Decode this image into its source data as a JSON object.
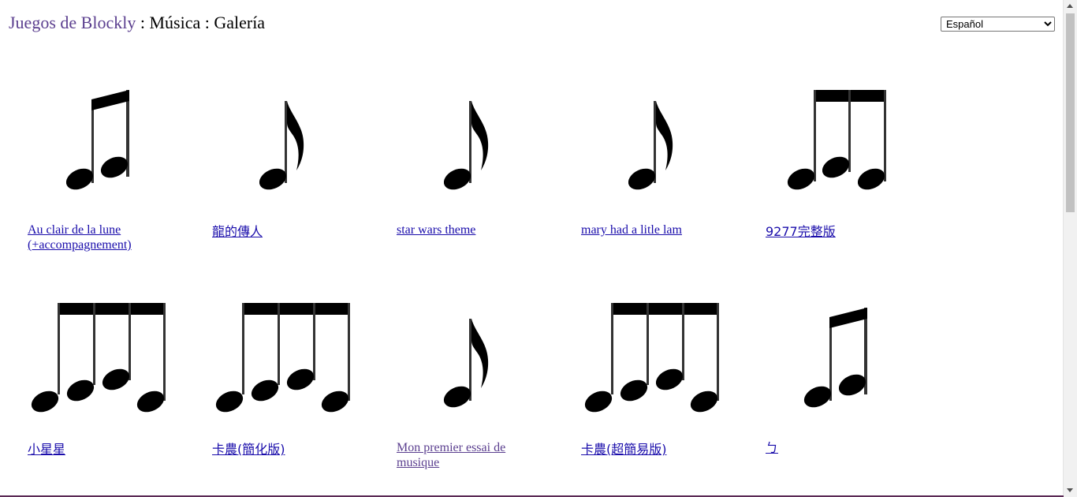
{
  "header": {
    "app_link": "Juegos de Blockly",
    "separator1": " : ",
    "section": "Música",
    "separator2": " : ",
    "page": "Galería"
  },
  "language_select": {
    "selected": "Español"
  },
  "gallery": [
    {
      "title": "Au clair de la lune (+accompagnement)",
      "icon": "beamed-two-notes-icon"
    },
    {
      "title": "龍的傳人",
      "icon": "eighth-note-icon"
    },
    {
      "title": "star wars theme",
      "icon": "eighth-note-icon"
    },
    {
      "title": "mary had a litle lam",
      "icon": "eighth-note-icon"
    },
    {
      "title": "9277完整版",
      "icon": "beamed-three-notes-icon"
    },
    {
      "title": "小星星",
      "icon": "beamed-four-notes-icon"
    },
    {
      "title": "卡農(簡化版)",
      "icon": "beamed-four-notes-icon"
    },
    {
      "title": "Mon premier essai de musique",
      "icon": "eighth-note-icon"
    },
    {
      "title": "卡農(超簡易版)",
      "icon": "beamed-four-notes-icon"
    },
    {
      "title": "ㄅ",
      "icon": "beamed-two-notes-icon"
    }
  ],
  "colors": {
    "link": "#1a0dab",
    "visited_link": "#5b3f8f",
    "header_link": "#5b3f8f"
  }
}
